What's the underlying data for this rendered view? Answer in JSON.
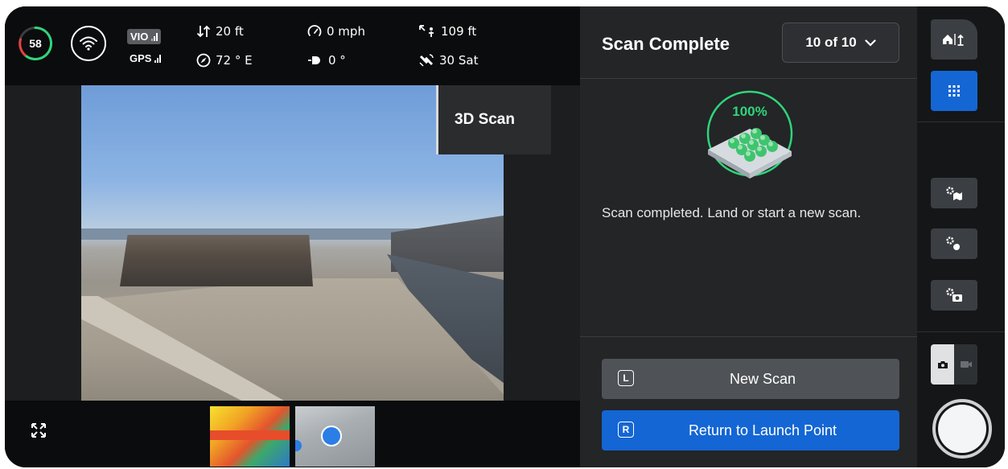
{
  "telemetry": {
    "battery_percent": "58",
    "vio_label": "VIO",
    "gps_label": "GPS",
    "altitude": "20 ft",
    "speed": "0 mph",
    "distance": "109 ft",
    "heading": "72 ° E",
    "gimbal_angle": "0 °",
    "satellites": "30 Sat"
  },
  "video": {
    "mode_label": "3D Scan"
  },
  "panel": {
    "title": "Scan Complete",
    "scan_counter": "10 of 10",
    "progress_label": "100%",
    "status_message": "Scan completed. Land or start a new scan.",
    "new_scan": {
      "key": "L",
      "label": "New Scan"
    },
    "return_launch": {
      "key": "R",
      "label": "Return to Launch Point"
    }
  },
  "colors": {
    "accent_blue": "#1466d4",
    "progress_green": "#2fd57a",
    "panel_bg": "#232527"
  },
  "icons": [
    "wifi-icon",
    "altitude-icon",
    "speedometer-icon",
    "distance-icon",
    "compass-icon",
    "gimbal-icon",
    "satellite-icon",
    "expand-icon",
    "chevron-down-icon",
    "home-altitude-icon",
    "grid-icon",
    "settings-map-icon",
    "settings-obstacle-icon",
    "settings-camera-icon",
    "photo-icon",
    "video-icon"
  ]
}
